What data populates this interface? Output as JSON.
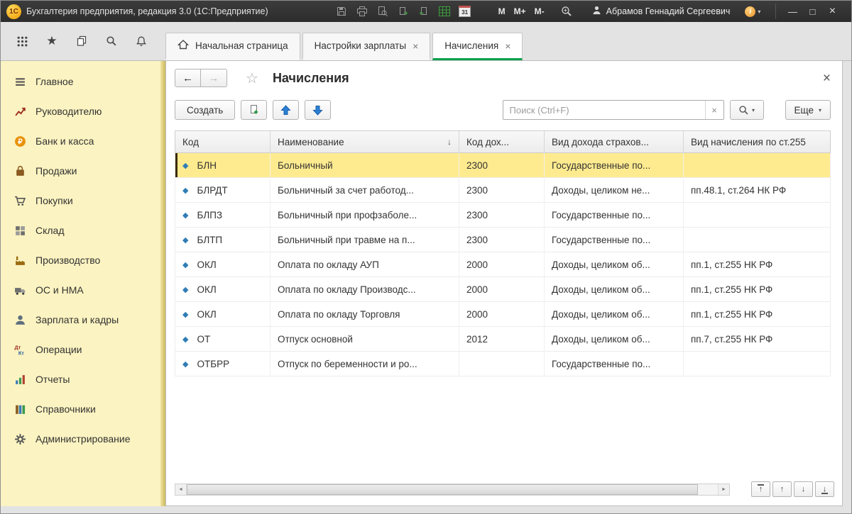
{
  "titlebar": {
    "logo_text": "1С",
    "app_title": "Бухгалтерия предприятия, редакция 3.0  (1С:Предприятие)",
    "memory_buttons": [
      "M",
      "M+",
      "M-"
    ],
    "user_name": "Абрамов Геннадий Сергеевич",
    "calendar_day": "31"
  },
  "tabbar": {
    "tabs": [
      {
        "id": "home",
        "label": "Начальная страница"
      },
      {
        "id": "salary-settings",
        "label": "Настройки зарплаты"
      },
      {
        "id": "accruals",
        "label": "Начисления",
        "active": true
      }
    ]
  },
  "sidebar": {
    "items": [
      {
        "id": "glavnoe",
        "label": "Главное",
        "icon": "main-menu-icon"
      },
      {
        "id": "rukovoditelyu",
        "label": "Руководителю",
        "icon": "trend-chart-icon"
      },
      {
        "id": "bank-i-kassa",
        "label": "Банк и касса",
        "icon": "ruble-icon"
      },
      {
        "id": "prodazhi",
        "label": "Продажи",
        "icon": "sales-bag-icon"
      },
      {
        "id": "pokupki",
        "label": "Покупки",
        "icon": "cart-icon"
      },
      {
        "id": "sklad",
        "label": "Склад",
        "icon": "warehouse-icon"
      },
      {
        "id": "proizvodstvo",
        "label": "Производство",
        "icon": "production-icon"
      },
      {
        "id": "os-i-nma",
        "label": "ОС и НМА",
        "icon": "truck-icon"
      },
      {
        "id": "zarplata-i-kadry",
        "label": "Зарплата и кадры",
        "icon": "person-icon"
      },
      {
        "id": "operacii",
        "label": "Операции",
        "icon": "dt-kt-icon"
      },
      {
        "id": "otchety",
        "label": "Отчеты",
        "icon": "report-bars-icon"
      },
      {
        "id": "spravochniki",
        "label": "Справочники",
        "icon": "books-icon"
      },
      {
        "id": "administrirovanie",
        "label": "Администрирование",
        "icon": "gear-icon"
      }
    ]
  },
  "page": {
    "title": "Начисления",
    "toolbar": {
      "create_label": "Создать",
      "more_label": "Еще",
      "search_placeholder": "Поиск (Ctrl+F)"
    },
    "table": {
      "columns": [
        "Код",
        "Наименование",
        "Код дох...",
        "Вид дохода страхов...",
        "Вид начисления по ст.255"
      ],
      "rows": [
        {
          "code": "БЛН",
          "name": "Больничный",
          "income_code": "2300",
          "insurance_income_type": "Государственные по...",
          "article255": "",
          "selected": true
        },
        {
          "code": "БЛРДТ",
          "name": "Больничный за счет работод...",
          "income_code": "2300",
          "insurance_income_type": "Доходы, целиком не...",
          "article255": "пп.48.1, ст.264 НК РФ"
        },
        {
          "code": "БЛПЗ",
          "name": "Больничный при профзаболе...",
          "income_code": "2300",
          "insurance_income_type": "Государственные по...",
          "article255": ""
        },
        {
          "code": "БЛТП",
          "name": "Больничный при травме на п...",
          "income_code": "2300",
          "insurance_income_type": "Государственные по...",
          "article255": ""
        },
        {
          "code": "ОКЛ",
          "name": "Оплата по окладу АУП",
          "income_code": "2000",
          "insurance_income_type": "Доходы, целиком об...",
          "article255": "пп.1, ст.255 НК РФ"
        },
        {
          "code": "ОКЛ",
          "name": "Оплата по окладу Производс...",
          "income_code": "2000",
          "insurance_income_type": "Доходы, целиком об...",
          "article255": "пп.1, ст.255 НК РФ"
        },
        {
          "code": "ОКЛ",
          "name": "Оплата по окладу Торговля",
          "income_code": "2000",
          "insurance_income_type": "Доходы, целиком об...",
          "article255": "пп.1, ст.255 НК РФ"
        },
        {
          "code": "ОТ",
          "name": "Отпуск основной",
          "income_code": "2012",
          "insurance_income_type": "Доходы, целиком об...",
          "article255": "пп.7, ст.255 НК РФ"
        },
        {
          "code": "ОТБРР",
          "name": "Отпуск по беременности и ро...",
          "income_code": "",
          "insurance_income_type": "Государственные по...",
          "article255": ""
        }
      ]
    }
  },
  "icons": {
    "caret": "▾",
    "close": "×",
    "minimize": "—",
    "maximize": "□",
    "star_filled": "★",
    "star_outline": "☆",
    "diamond": "◆",
    "sort_desc": "↓",
    "back": "←",
    "forward": "→",
    "left_small": "◄",
    "right_small": "►",
    "up": "↑",
    "down": "↓"
  },
  "colors": {
    "active_tab_underline": "#0aa14e",
    "sidebar_bg": "#fbf3c1",
    "selected_row_bg": "#ffeb8f",
    "toolbar_arrow_blue": "#2a80d6",
    "titlebar_bg": "#2c2c2c"
  }
}
